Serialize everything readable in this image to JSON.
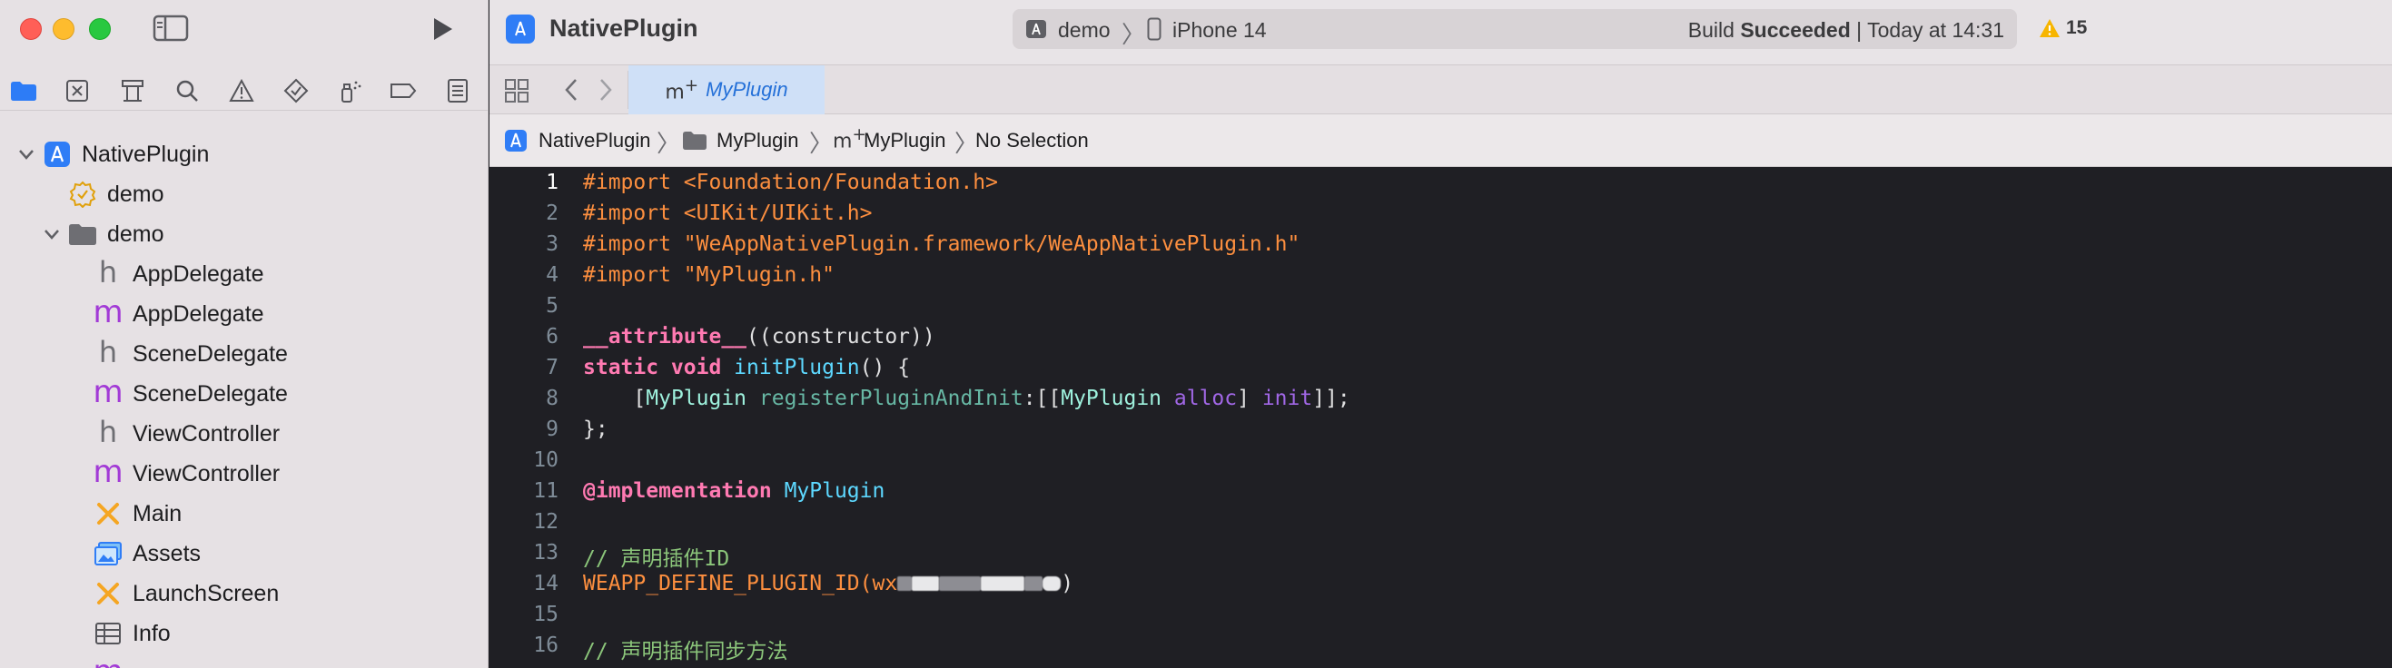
{
  "window": {
    "project_title": "NativePlugin",
    "scheme": "demo",
    "device": "iPhone 14",
    "build_status_prefix": "Build ",
    "build_status_bold": "Succeeded",
    "build_status_suffix": " | Today at 14:31",
    "warning_count": "15"
  },
  "sidebar": {
    "tree": [
      {
        "label": "NativePlugin",
        "icon": "xcodeproj-icon",
        "level": 0,
        "disclosure": "open"
      },
      {
        "label": "demo",
        "icon": "target-gear-icon",
        "level": 1,
        "disclosure": "none"
      },
      {
        "label": "demo",
        "icon": "folder-icon",
        "level": 1,
        "disclosure": "open"
      },
      {
        "label": "AppDelegate",
        "icon": "header-h-icon",
        "level": 2
      },
      {
        "label": "AppDelegate",
        "icon": "objc-m-icon",
        "level": 2
      },
      {
        "label": "SceneDelegate",
        "icon": "header-h-icon",
        "level": 2
      },
      {
        "label": "SceneDelegate",
        "icon": "objc-m-icon",
        "level": 2
      },
      {
        "label": "ViewController",
        "icon": "header-h-icon",
        "level": 2
      },
      {
        "label": "ViewController",
        "icon": "objc-m-icon",
        "level": 2
      },
      {
        "label": "Main",
        "icon": "storyboard-icon",
        "level": 2
      },
      {
        "label": "Assets",
        "icon": "asset-catalog-icon",
        "level": 2
      },
      {
        "label": "LaunchScreen",
        "icon": "storyboard-icon",
        "level": 2
      },
      {
        "label": "Info",
        "icon": "plist-table-icon",
        "level": 2
      }
    ]
  },
  "editor": {
    "tab_label": "MyPlugin",
    "tab_icon_text": "m",
    "tab_icon_plus": "+",
    "jump_bar": [
      "NativePlugin",
      "MyPlugin",
      "MyPlugin",
      "No Selection"
    ],
    "lines": [
      {
        "n": "1",
        "text": "#import <Foundation/Foundation.h>"
      },
      {
        "n": "2",
        "text": "#import <UIKit/UIKit.h>"
      },
      {
        "n": "3",
        "text": "#import \"WeAppNativePlugin.framework/WeAppNativePlugin.h\""
      },
      {
        "n": "4",
        "text": "#import \"MyPlugin.h\""
      },
      {
        "n": "5",
        "text": ""
      },
      {
        "n": "6",
        "text": "__attribute__((constructor))"
      },
      {
        "n": "7",
        "text": "static void initPlugin() {"
      },
      {
        "n": "8",
        "text": "    [MyPlugin registerPluginAndInit:[[MyPlugin alloc] init]];"
      },
      {
        "n": "9",
        "text": "};"
      },
      {
        "n": "10",
        "text": ""
      },
      {
        "n": "11",
        "text": "@implementation MyPlugin"
      },
      {
        "n": "12",
        "text": ""
      },
      {
        "n": "13",
        "text": "// 声明插件ID"
      },
      {
        "n": "14",
        "text": "WEAPP_DEFINE_PLUGIN_ID(wx"
      },
      {
        "n": "15",
        "text": ""
      },
      {
        "n": "16",
        "text": "// 声明插件同步方法"
      }
    ]
  },
  "colors": {
    "keyword": "#ff7ab2",
    "preprocessor": "#fd8f3f",
    "string": "#fc6a5d",
    "class": "#9ef1dd",
    "function": "#67b7a4",
    "method": "#a167e6",
    "comment": "#6c7986",
    "accent": "#2470d8"
  }
}
